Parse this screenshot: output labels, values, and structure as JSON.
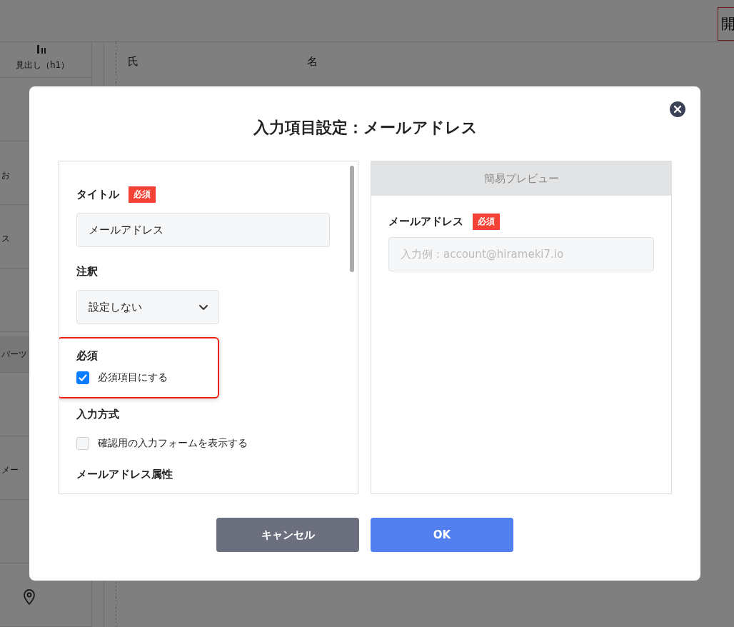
{
  "page": {
    "header_button": "開",
    "sidebar": {
      "items": [
        {
          "kind": "heading",
          "label": "見出し（h1）",
          "selected": false
        },
        {
          "kind": "plain",
          "selected": false
        },
        {
          "kind": "plain",
          "label": "お",
          "selected": false
        },
        {
          "kind": "plain",
          "label": "ス",
          "selected": false
        },
        {
          "kind": "plain",
          "selected": false
        },
        {
          "kind": "plain",
          "label": "パーツ",
          "selected": true
        },
        {
          "kind": "plain",
          "selected": false
        },
        {
          "kind": "plain",
          "label": "メー",
          "selected": false
        },
        {
          "kind": "plain",
          "selected": false
        },
        {
          "kind": "pin",
          "selected": false
        }
      ]
    },
    "form": {
      "name_labels": [
        "氏",
        "名"
      ]
    }
  },
  "modal": {
    "title": "入力項目設定：メールアドレス",
    "sections": [
      {
        "kind": "text",
        "label": "タイトル",
        "badge": "必須",
        "value": "メールアドレス"
      },
      {
        "kind": "select",
        "label": "注釈",
        "value": "設定しない"
      },
      {
        "kind": "checkbox",
        "label": "必須",
        "highlighted": true,
        "option": {
          "label": "必須項目にする",
          "checked": true
        }
      },
      {
        "kind": "checkbox",
        "label": "入力方式",
        "option": {
          "label": "確認用の入力フォームを表示する",
          "checked": false
        }
      },
      {
        "kind": "heading",
        "label": "メールアドレス属性"
      }
    ],
    "preview": {
      "header": "簡易プレビュー",
      "field": {
        "label": "メールアドレス",
        "badge": "必須",
        "placeholder": "入力例：account@hirameki7.io"
      }
    },
    "buttons": [
      {
        "label": "キャンセル",
        "kind": "secondary"
      },
      {
        "label": "OK",
        "kind": "primary"
      }
    ]
  }
}
